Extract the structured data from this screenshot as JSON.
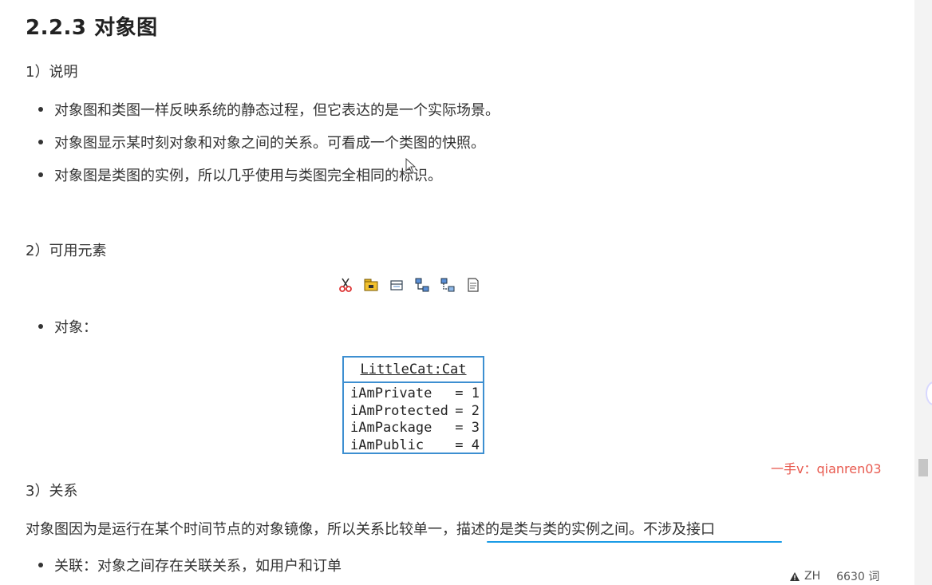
{
  "doc": {
    "heading": "2.2.3 对象图",
    "section1": {
      "title": "1）说明",
      "bullets": [
        "对象图和类图一样反映系统的静态过程，但它表达的是一个实际场景。",
        "对象图显示某时刻对象和对象之间的关系。可看成一个类图的快照。",
        "对象图是类图的实例，所以几乎使用与类图完全相同的标识。"
      ]
    },
    "section2": {
      "title": "2）可用元素",
      "toolbar_icons": [
        "scissors-icon",
        "package-icon",
        "object-icon",
        "link-icon",
        "link-alt-icon",
        "note-icon"
      ],
      "object_bullet": "对象："
    },
    "uml_object": {
      "name": "LittleCat:Cat",
      "attributes": [
        {
          "name": "iAmPrivate",
          "value": "= 1"
        },
        {
          "name": "iAmProtected",
          "value": "= 2"
        },
        {
          "name": "iAmPackage",
          "value": "= 3"
        },
        {
          "name": "iAmPublic",
          "value": "= 4"
        }
      ],
      "border_color": "#3d8fd1"
    },
    "watermark": "一手v：qianren03",
    "section3": {
      "title": "3）关系",
      "paragraph_part1": "对象图因为是运行在某个时间节点的对象镜像，所以关系比较单一，",
      "paragraph_part2": "描述的是类与类的实例之间。不涉及接口",
      "bullets": [
        "关联：对象之间存在关联关系，如用户和订单"
      ]
    }
  },
  "status_bar": {
    "language": "ZH",
    "word_count": "6630 词"
  },
  "colors": {
    "accent_underline": "#1a9be6",
    "watermark": "#e85a4f",
    "text": "#333333"
  }
}
